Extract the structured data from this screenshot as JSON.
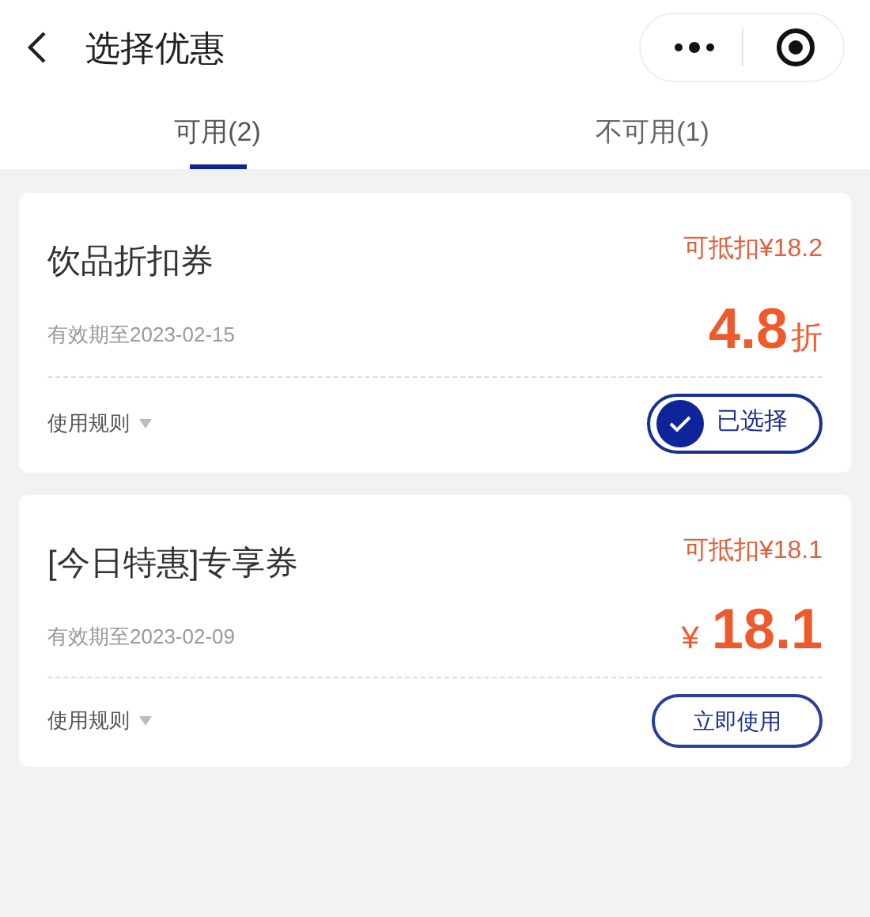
{
  "header": {
    "title": "选择优惠"
  },
  "tabs": [
    {
      "label": "可用(2)",
      "selected": true
    },
    {
      "label": "不可用(1)",
      "selected": false
    }
  ],
  "coupons": [
    {
      "name": "饮品折扣券",
      "deduct": "可抵扣¥18.2",
      "validity": "有效期至2023-02-15",
      "value": {
        "kind": "discount",
        "number": "4.8",
        "unit": "折"
      },
      "rules": "使用规则",
      "button": "已选择",
      "selected": true
    },
    {
      "name": "[今日特惠]专享券",
      "deduct": "可抵扣¥18.1",
      "validity": "有效期至2023-02-09",
      "value": {
        "kind": "amount",
        "number": "18.1",
        "unit": "¥"
      },
      "rules": "使用规则",
      "button": "立即使用",
      "selected": false
    }
  ]
}
